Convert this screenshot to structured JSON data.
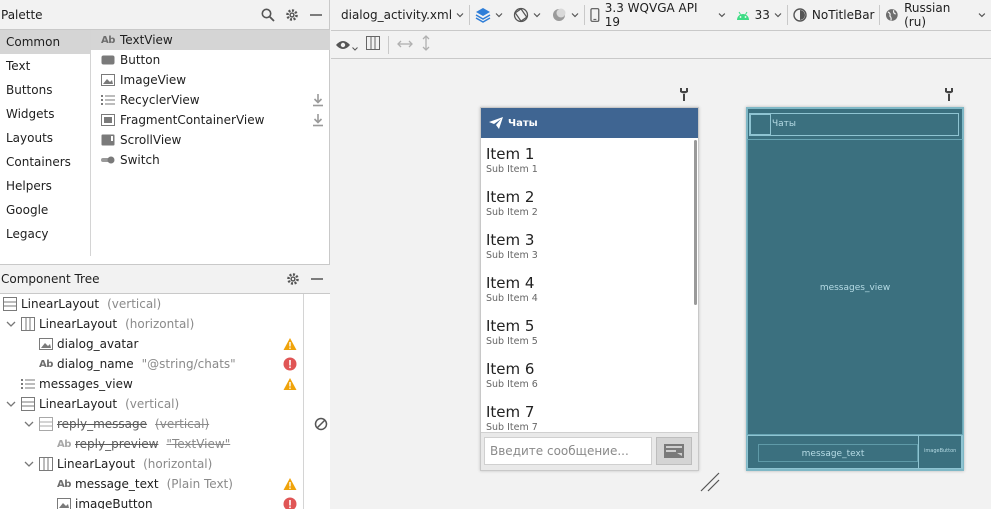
{
  "palette": {
    "title": "Palette",
    "categories": [
      {
        "label": "Common",
        "selected": true
      },
      {
        "label": "Text"
      },
      {
        "label": "Buttons"
      },
      {
        "label": "Widgets"
      },
      {
        "label": "Layouts"
      },
      {
        "label": "Containers"
      },
      {
        "label": "Helpers"
      },
      {
        "label": "Google"
      },
      {
        "label": "Legacy"
      }
    ],
    "widgets": [
      {
        "label": "TextView",
        "icon": "textview-icon",
        "selected": true
      },
      {
        "label": "Button",
        "icon": "button-icon"
      },
      {
        "label": "ImageView",
        "icon": "imageview-icon"
      },
      {
        "label": "RecyclerView",
        "icon": "recyclerview-icon",
        "download": true
      },
      {
        "label": "FragmentContainerView",
        "icon": "fragment-icon",
        "download": true
      },
      {
        "label": "ScrollView",
        "icon": "scrollview-icon"
      },
      {
        "label": "Switch",
        "icon": "switch-icon"
      }
    ]
  },
  "component_tree": {
    "title": "Component Tree",
    "nodes": [
      {
        "name": "LinearLayout",
        "detail": "(vertical)",
        "depth": 0
      },
      {
        "name": "LinearLayout",
        "detail": "(horizontal)",
        "depth": 1
      },
      {
        "name": "dialog_avatar",
        "detail": "",
        "depth": 2
      },
      {
        "name": "dialog_name",
        "detail": "\"@string/chats\"",
        "depth": 2
      },
      {
        "name": "messages_view",
        "detail": "",
        "depth": 1
      },
      {
        "name": "LinearLayout",
        "detail": "(vertical)",
        "depth": 1
      },
      {
        "name": "reply_message",
        "detail": "(vertical)",
        "depth": 2
      },
      {
        "name": "reply_preview",
        "detail": "\"TextView\"",
        "depth": 3
      },
      {
        "name": "LinearLayout",
        "detail": "(horizontal)",
        "depth": 2
      },
      {
        "name": "message_text",
        "detail": "(Plain Text)",
        "depth": 3
      },
      {
        "name": "imageButton",
        "detail": "",
        "depth": 3
      }
    ]
  },
  "toolbar": {
    "file": "dialog_activity.xml",
    "device": "3.3  WQVGA API 19",
    "api": "33",
    "theme": "NoTitleBar",
    "locale": "Russian (ru)"
  },
  "preview": {
    "header_title": "Чаты",
    "items": [
      {
        "title": "Item 1",
        "sub": "Sub Item 1"
      },
      {
        "title": "Item 2",
        "sub": "Sub Item 2"
      },
      {
        "title": "Item 3",
        "sub": "Sub Item 3"
      },
      {
        "title": "Item 4",
        "sub": "Sub Item 4"
      },
      {
        "title": "Item 5",
        "sub": "Sub Item 5"
      },
      {
        "title": "Item 6",
        "sub": "Sub Item 6"
      },
      {
        "title": "Item 7",
        "sub": "Sub Item 7"
      }
    ],
    "input_placeholder": "Введите сообщение..."
  },
  "blueprint": {
    "header_label": "Чаты",
    "messages_label": "messages_view",
    "message_label": "message_text",
    "button_label": "imageButton"
  },
  "colors": {
    "accent_header": "#3f6592",
    "blueprint_bg": "#3b707f",
    "warning": "#f0a30a",
    "error": "#e05555"
  }
}
